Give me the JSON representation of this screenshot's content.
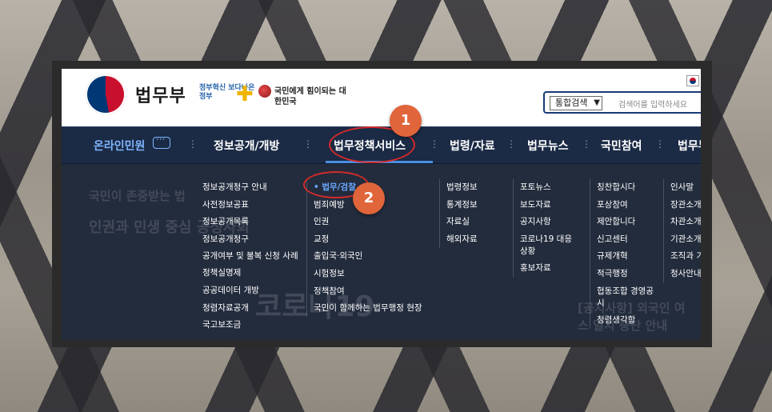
{
  "header": {
    "ministry_name": "법무부",
    "slogan_left": "정부혁신 보다나은 정부",
    "slogan_right": "국민에게 힘이되는 대한민국"
  },
  "search": {
    "scope_selected": "통합검색",
    "placeholder": "검색어를 입력하세요"
  },
  "nav": {
    "online": "온라인민원",
    "items": [
      "정보공개/개방",
      "법무정책서비스",
      "법령/자료",
      "법무뉴스",
      "국민참여",
      "법무부"
    ]
  },
  "background_ghost": {
    "line1": "국민이 존중받는 법",
    "line2": "인권과 민생 중심 공정사회",
    "line3": "코로나19",
    "line4": "[공지사항] 외국인 여",
    "line5": "스 일시 중단 안내"
  },
  "menu": {
    "col1": [
      "정보공개청구 안내",
      "사전정보공표",
      "정보공개목록",
      "정보공개청구",
      "공개여부 및 불복 신청 사례",
      "정책실명제",
      "공공데이터 개방",
      "청렴자료공개",
      "국고보조금"
    ],
    "col2": [
      "법무/검찰",
      "범죄예방",
      "인권",
      "교정",
      "출입국·외국인",
      "시험정보",
      "정책참여",
      "국민이 함께하는 법무행정 현장"
    ],
    "col3": [
      "법령정보",
      "통계정보",
      "자료실",
      "해외자료"
    ],
    "col4": [
      "포토뉴스",
      "보도자료",
      "공지사항",
      "코로나19 대응 상황",
      "홍보자료"
    ],
    "col5": [
      "칭찬합시다",
      "포상참여",
      "제안합니다",
      "신고센터",
      "규제개혁",
      "적극행정",
      "협동조합 경영공시",
      "청렴생각함"
    ],
    "col6": [
      "인사말",
      "장관소개",
      "차관소개",
      "기관소개",
      "조직과 기능",
      "청사안내"
    ]
  },
  "annotations": {
    "badge1": "1",
    "badge2": "2"
  },
  "colors": {
    "nav_bg": "#1b2a45",
    "accent": "#4a8fe0",
    "annotation": "#d42a2a",
    "badge": "#e0653a"
  }
}
